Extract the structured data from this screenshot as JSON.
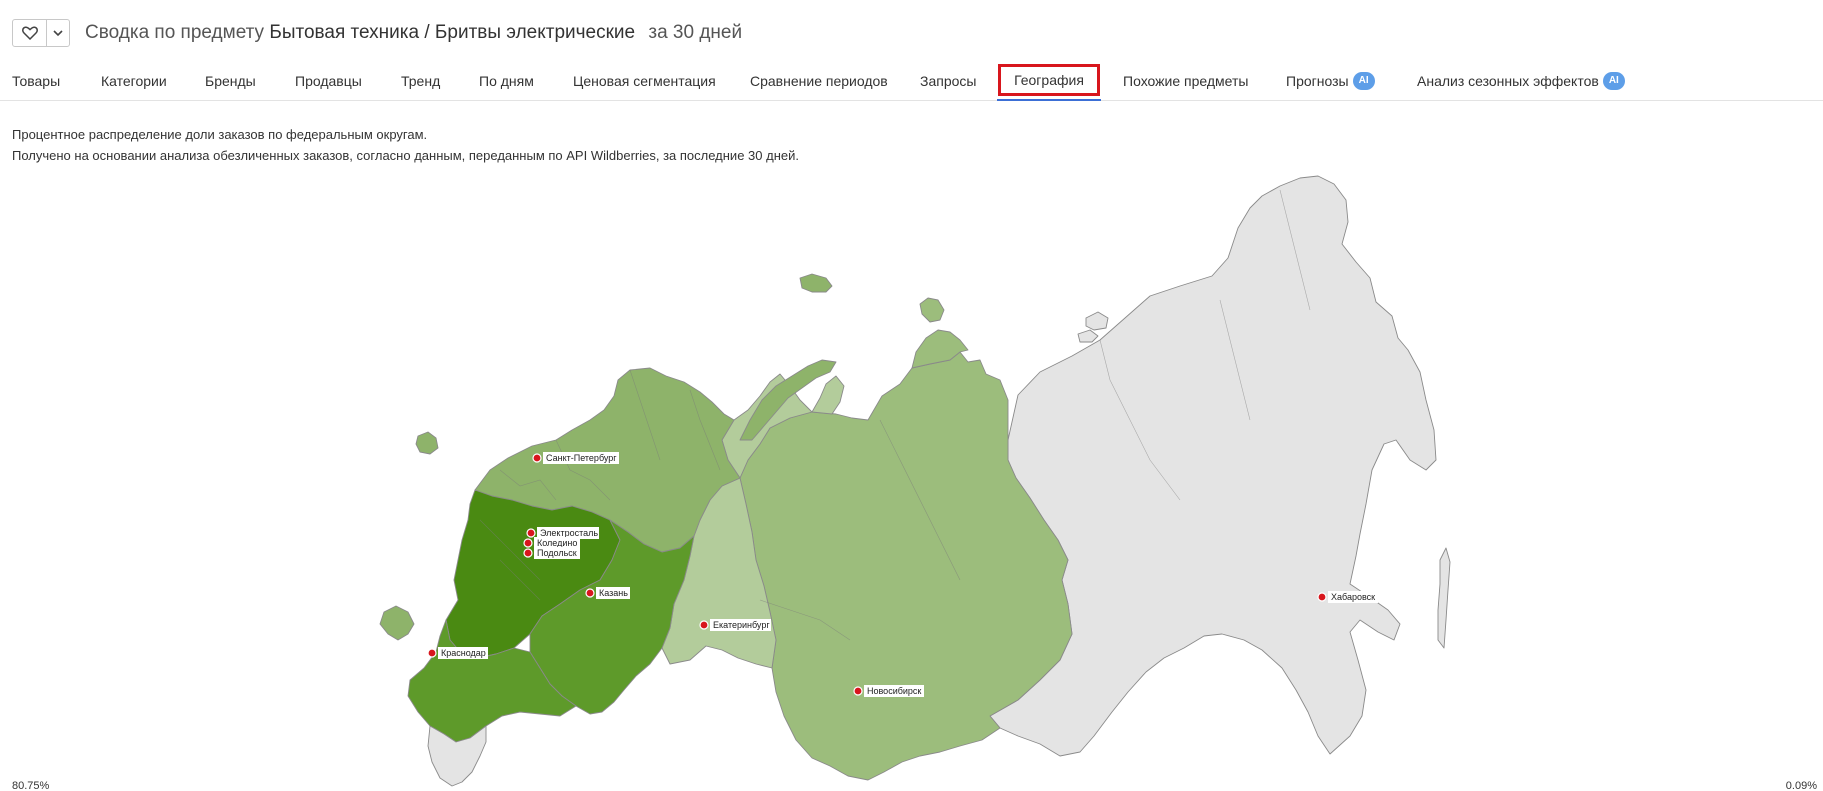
{
  "header": {
    "favorite_icon": "heart-icon",
    "dropdown_icon": "chevron-down-icon",
    "title_prefix": "Сводка по предмету",
    "subject": "Бытовая техника / Бритвы электрические",
    "period": "за 30 дней"
  },
  "tabs": [
    {
      "label": "Товары",
      "ai": ""
    },
    {
      "label": "Категории",
      "ai": ""
    },
    {
      "label": "Бренды",
      "ai": ""
    },
    {
      "label": "Продавцы",
      "ai": ""
    },
    {
      "label": "Тренд",
      "ai": ""
    },
    {
      "label": "По дням",
      "ai": ""
    },
    {
      "label": "Ценовая сегментация",
      "ai": ""
    },
    {
      "label": "Сравнение периодов",
      "ai": ""
    },
    {
      "label": "Запросы",
      "ai": ""
    },
    {
      "label": "География",
      "ai": ""
    },
    {
      "label": "Похожие предметы",
      "ai": ""
    },
    {
      "label": "Прогнозы",
      "ai": "AI"
    },
    {
      "label": "Анализ сезонных эффектов",
      "ai": "AI"
    }
  ],
  "active_tab": "География",
  "description": {
    "line1": "Процентное распределение доли заказов по федеральным округам.",
    "line2": "Получено на основании анализа обезличенных заказов, согласно данным, переданным по API Wildberries, за последние 30 дней."
  },
  "map": {
    "colors": {
      "highest": "#4a8a12",
      "high": "#5e9a2a",
      "medium": "#8eb36a",
      "medium_light": "#9cbd7c",
      "light": "#b3cc9b",
      "none": "#e4e4e4",
      "border": "#8a8a8a"
    },
    "cities": [
      "Санкт-Петербург",
      "Электросталь",
      "Коледино",
      "Подольск",
      "Казань",
      "Краснодар",
      "Екатеринбург",
      "Новосибирск",
      "Хабаровск"
    ]
  },
  "legend": {
    "min_value": "80.75%",
    "max_value": "0.09%"
  }
}
